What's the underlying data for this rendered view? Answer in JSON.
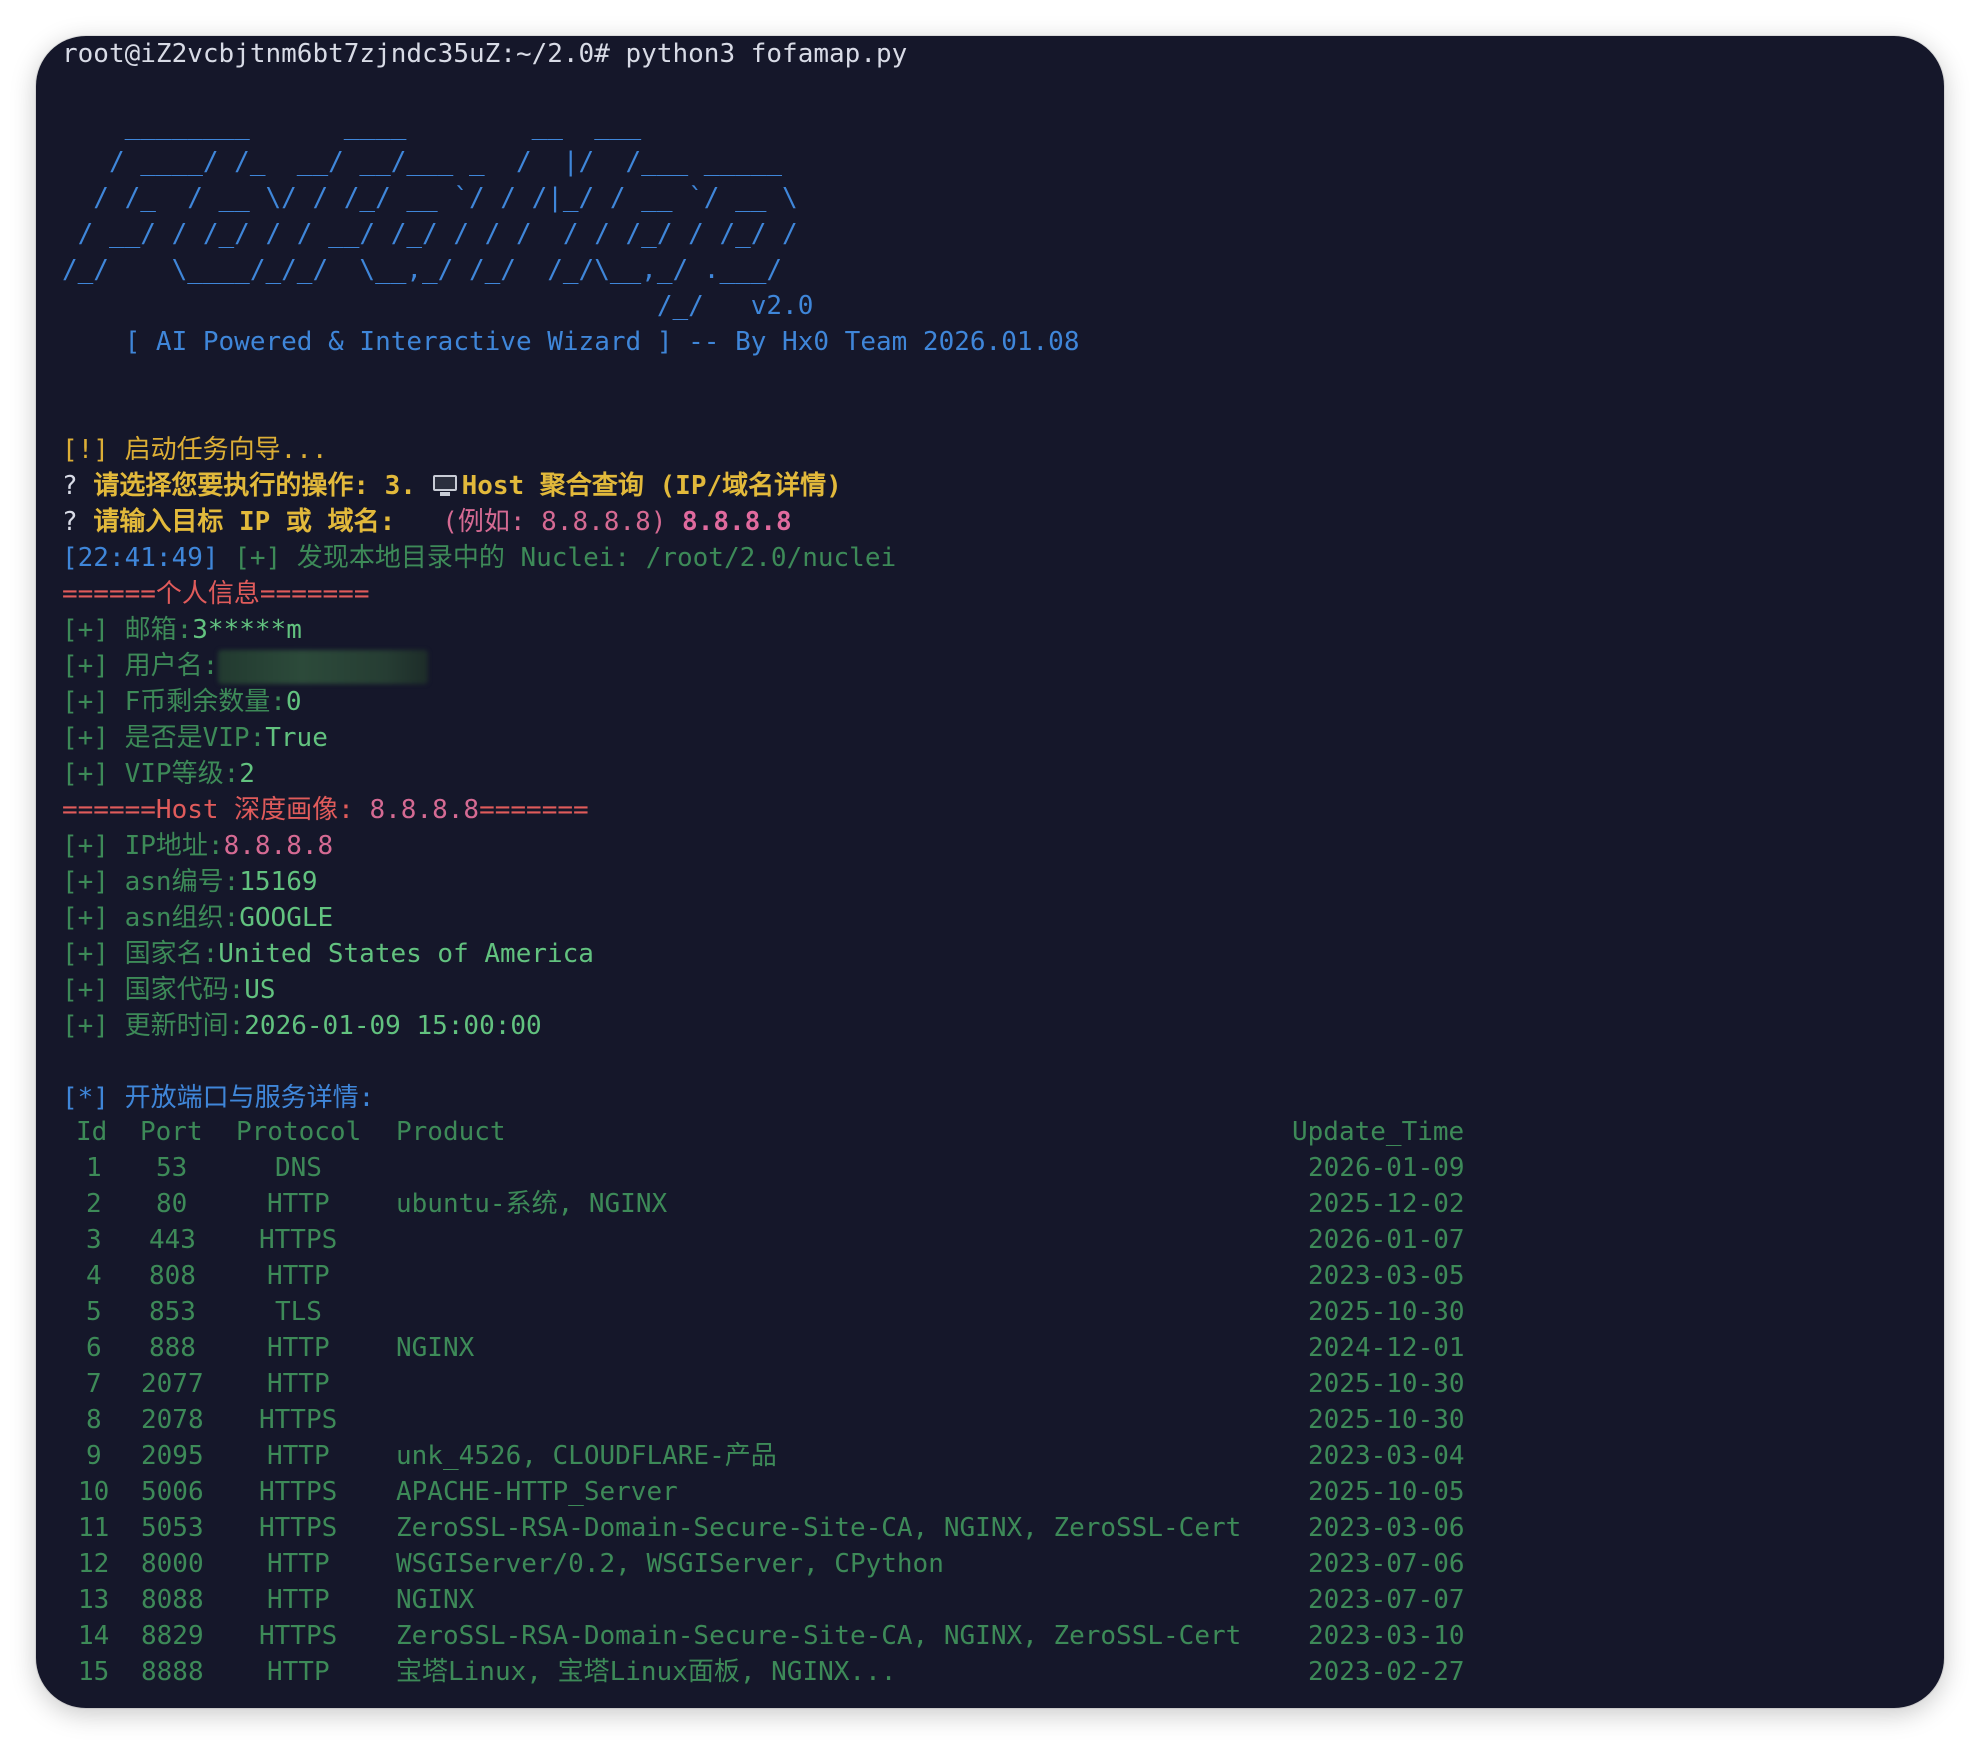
{
  "terminal": {
    "prompt": "root@iZ2vcbjtnm6bt7zjndc35uZ:~/2.0# python3 fofamap.py",
    "banner": [
      "    ________      ____        __  ___",
      "   / ____/ /_  __/ __/___ _  /  |/  /___ _____",
      "  / /_  / __ \\/ / /_/ __ `/ / /|_/ / __ `/ __ \\",
      " / __/ / /_/ / / __/ /_/ / / /  / / /_/ / /_/ /",
      "/_/    \\____/_/_/  \\__,_/ /_/  /_/\\__,_/ .___/",
      "                                      /_/   v2.0"
    ],
    "tagline": "    [ AI Powered & Interactive Wizard ] -- By Hx0 Team 2026.01.08",
    "wizard_start": "[!] 启动任务向导...",
    "q1_mark": "? ",
    "q1_text": "请选择您要执行的操作: ",
    "q1_answer_num": "3. ",
    "q1_answer_text": "Host 聚合查询 (IP/域名详情)",
    "q2_mark": "? ",
    "q2_text": "请输入目标 IP 或 域名: ",
    "q2_hint": "  (例如: 8.8.8.8) ",
    "q2_answer": "8.8.8.8",
    "log_time": "[22:41:49]",
    "log_text": " [+] 发现本地目录中的 Nuclei: /root/2.0/nuclei",
    "section_personal": "======个人信息=======",
    "personal": {
      "email_label": "[+] 邮箱:",
      "email_value": "3*****m",
      "username_label": "[+] 用户名:",
      "fcoin_label": "[+] F币剩余数量:",
      "fcoin_value": "0",
      "vip_label": "[+] 是否是VIP:",
      "vip_value": "True",
      "vip_level_label": "[+] VIP等级:",
      "vip_level_value": "2"
    },
    "section_host_prefix": "======Host 深度画像: ",
    "section_host_target": "8.8.8.8",
    "section_host_suffix": "=======",
    "host": {
      "ip_label": "[+] IP地址:",
      "ip_value": "8.8.8.8",
      "asn_label": "[+] asn编号:",
      "asn_value": "15169",
      "org_label": "[+] asn组织:",
      "org_value": "GOOGLE",
      "country_label": "[+] 国家名:",
      "country_value": "United States of America",
      "code_label": "[+] 国家代码:",
      "code_value": "US",
      "update_label": "[+] 更新时间:",
      "update_value": "2026-01-09 15:00:00"
    },
    "ports_heading": "[*] 开放端口与服务详情:",
    "table": {
      "headers": [
        "Id",
        "Port",
        "Protocol",
        "Product",
        "Update_Time"
      ],
      "rows": [
        [
          "1",
          "53",
          "DNS",
          "",
          "2026-01-09"
        ],
        [
          "2",
          "80",
          "HTTP",
          "ubuntu-系统, NGINX",
          "2025-12-02"
        ],
        [
          "3",
          "443",
          "HTTPS",
          "",
          "2026-01-07"
        ],
        [
          "4",
          "808",
          "HTTP",
          "",
          "2023-03-05"
        ],
        [
          "5",
          "853",
          "TLS",
          "",
          "2025-10-30"
        ],
        [
          "6",
          "888",
          "HTTP",
          "NGINX",
          "2024-12-01"
        ],
        [
          "7",
          "2077",
          "HTTP",
          "",
          "2025-10-30"
        ],
        [
          "8",
          "2078",
          "HTTPS",
          "",
          "2025-10-30"
        ],
        [
          "9",
          "2095",
          "HTTP",
          "unk_4526, CLOUDFLARE-产品",
          "2023-03-04"
        ],
        [
          "10",
          "5006",
          "HTTPS",
          "APACHE-HTTP_Server",
          "2025-10-05"
        ],
        [
          "11",
          "5053",
          "HTTPS",
          "ZeroSSL-RSA-Domain-Secure-Site-CA, NGINX, ZeroSSL-Cert",
          "2023-03-06"
        ],
        [
          "12",
          "8000",
          "HTTP",
          "WSGIServer/0.2, WSGIServer, CPython",
          "2023-07-06"
        ],
        [
          "13",
          "8088",
          "HTTP",
          "NGINX",
          "2023-07-07"
        ],
        [
          "14",
          "8829",
          "HTTPS",
          "ZeroSSL-RSA-Domain-Secure-Site-CA, NGINX, ZeroSSL-Cert",
          "2023-03-10"
        ],
        [
          "15",
          "8888",
          "HTTP",
          "宝塔Linux, 宝塔Linux面板, NGINX...",
          "2023-02-27"
        ]
      ]
    }
  }
}
